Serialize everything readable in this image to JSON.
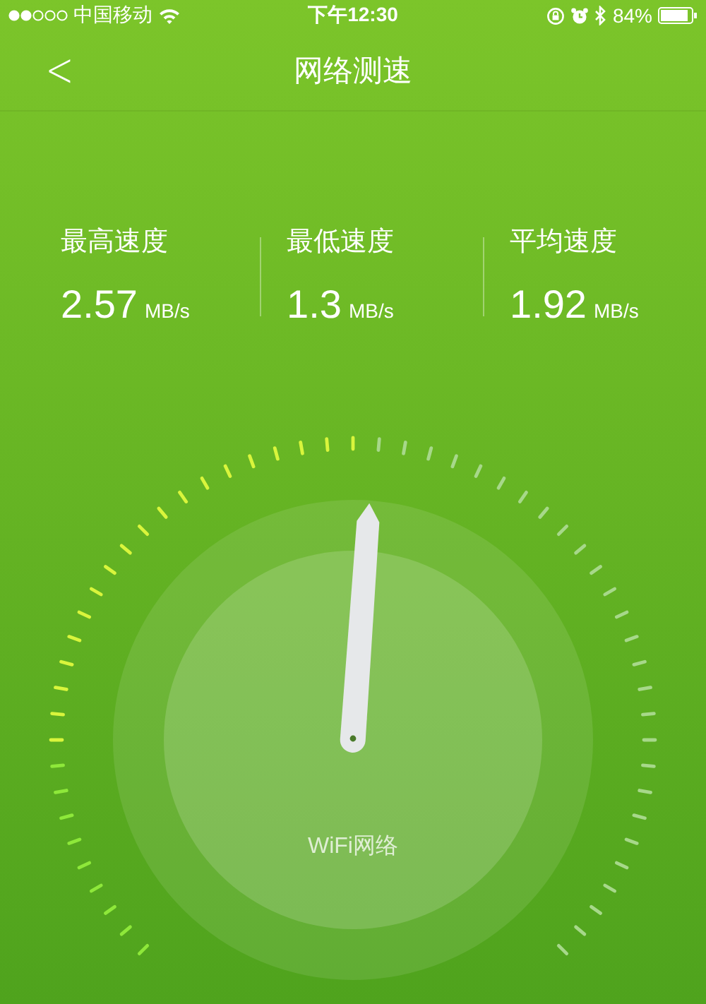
{
  "status_bar": {
    "carrier": "中国移动",
    "time": "下午12:30",
    "battery": "84%"
  },
  "nav": {
    "back": "<",
    "title": "网络测速"
  },
  "stats": [
    {
      "label": "最高速度",
      "value": "2.57",
      "unit": "MB/s"
    },
    {
      "label": "最低速度",
      "value": "1.3",
      "unit": "MB/s"
    },
    {
      "label": "平均速度",
      "value": "1.92",
      "unit": "MB/s"
    }
  ],
  "gauge": {
    "network": "WiFi网络"
  }
}
